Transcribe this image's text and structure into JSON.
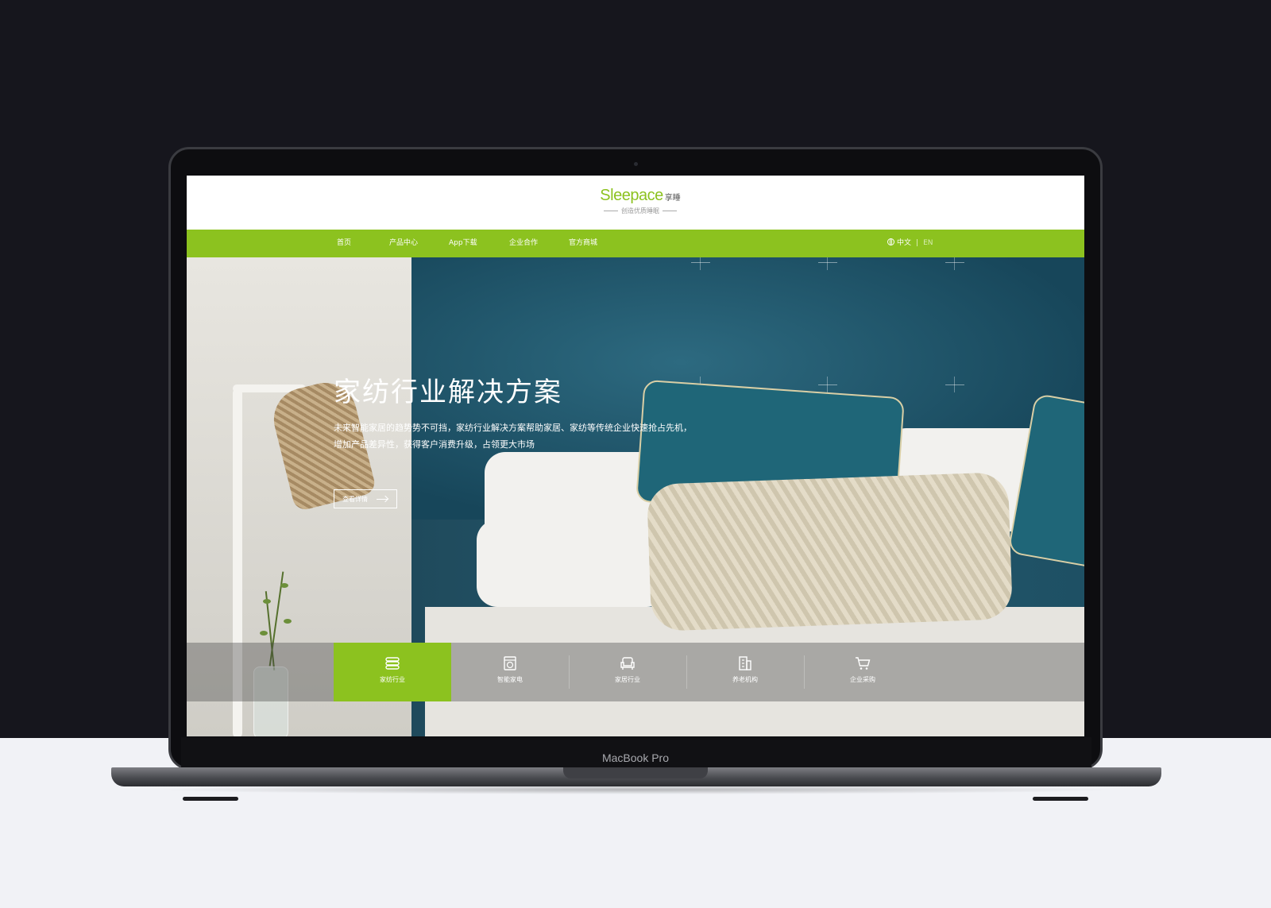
{
  "device": {
    "brand_label": "MacBook Pro"
  },
  "header": {
    "logo_text": "Sleepace",
    "logo_cn": "享睡",
    "tagline": "创造优质睡眠"
  },
  "nav": {
    "items": [
      {
        "label": "首页"
      },
      {
        "label": "产品中心"
      },
      {
        "label": "App下载"
      },
      {
        "label": "企业合作"
      },
      {
        "label": "官方商城"
      }
    ],
    "lang_cn": "中文",
    "lang_sep": "|",
    "lang_en": "EN"
  },
  "hero": {
    "title": "家纺行业解决方案",
    "description": "未来智能家居的趋势势不可挡，家纺行业解决方案帮助家居、家纺等传统企业快速抢占先机，增加产品差异性，获得客户消费升级，占领更大市场",
    "button_label": "查看详情"
  },
  "tabs": [
    {
      "label": "家纺行业",
      "icon": "bedding-icon",
      "active": true
    },
    {
      "label": "智能家电",
      "icon": "appliance-icon",
      "active": false
    },
    {
      "label": "家居行业",
      "icon": "sofa-icon",
      "active": false
    },
    {
      "label": "养老机构",
      "icon": "building-icon",
      "active": false
    },
    {
      "label": "企业采购",
      "icon": "cart-icon",
      "active": false
    }
  ],
  "colors": {
    "brand_green": "#8cc21f",
    "dark_bg": "#16161d",
    "light_bg": "#f1f2f6"
  }
}
